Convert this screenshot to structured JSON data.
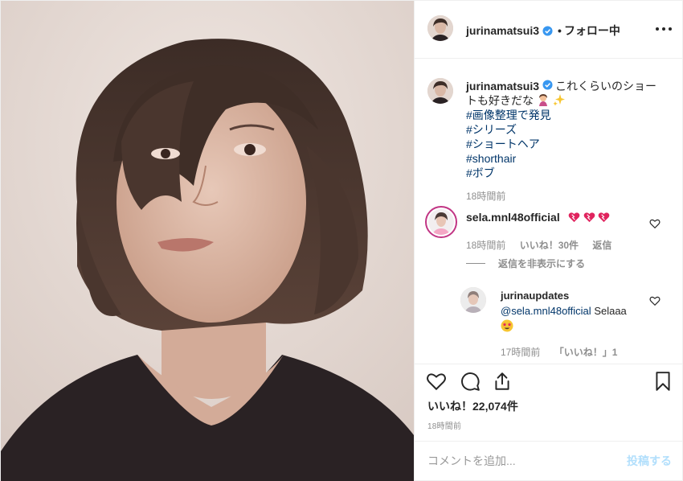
{
  "header": {
    "username": "jurinamatsui3",
    "separator": "•",
    "follow_status": "フォロー中",
    "more_icon": "more-horizontal-icon"
  },
  "caption": {
    "username": "jurinamatsui3",
    "text_line1": "これくらいのショー",
    "text_line2": "トも好きだな",
    "hashtags": [
      "#画像整理で発見",
      "#シリーズ",
      "#ショートヘア",
      "#shorthair",
      "#ボブ"
    ],
    "time": "18時間前"
  },
  "comment1": {
    "username": "sela.mnl48official",
    "time": "18時間前",
    "likes": "いいね！30件",
    "reply": "返信",
    "hide_replies": "返信を非表示にする"
  },
  "reply1": {
    "username": "jurinaupdates",
    "mention": "@sela.mnl48official",
    "text": "Selaaa",
    "time": "17時間前",
    "likes": "「いいね！」1"
  },
  "actions": {
    "like_icon": "heart-icon",
    "comment_icon": "comment-icon",
    "share_icon": "share-icon",
    "save_icon": "bookmark-icon"
  },
  "likes_count": "いいね！22,074件",
  "post_time": "18時間前",
  "composer": {
    "placeholder": "コメントを追加...",
    "post_label": "投稿する"
  },
  "colors": {
    "text": "#262626",
    "muted": "#8e8e8e",
    "link": "#003569",
    "verified": "#3897f0",
    "post_button_disabled": "#b2dffc",
    "story_ring": "#c13584"
  }
}
